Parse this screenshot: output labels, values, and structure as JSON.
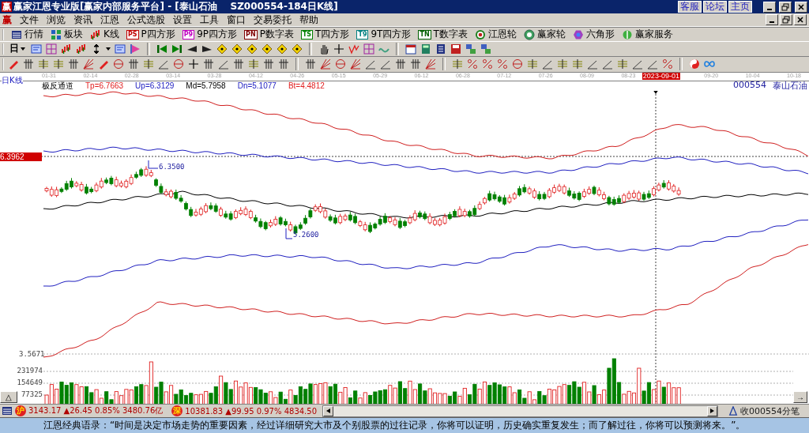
{
  "window": {
    "app_icon": "赢",
    "title": "赢家江恩专业版[赢家内部服务平台] - [泰山石油    SZ000554-184日K线]",
    "links": [
      "客服",
      "论坛",
      "主页"
    ]
  },
  "menu": {
    "app_icon": "赢",
    "items": [
      "文件",
      "浏览",
      "资讯",
      "江恩",
      "公式选股",
      "设置",
      "工具",
      "窗口",
      "交易委托",
      "帮助"
    ]
  },
  "toolbar": {
    "buttons": [
      {
        "kind": "table",
        "label": "行情"
      },
      {
        "kind": "blocks",
        "label": "板块"
      },
      {
        "kind": "candles",
        "label": "K线"
      },
      {
        "kind": "badge",
        "badge": "PS",
        "color": "#c00000",
        "label": "P四方形"
      },
      {
        "kind": "badge",
        "badge": "P9",
        "color": "#c000c0",
        "label": "9P四方形"
      },
      {
        "kind": "badge",
        "badge": "PN",
        "color": "#800000",
        "label": "P数字表"
      },
      {
        "kind": "badge",
        "badge": "TS",
        "color": "#008000",
        "label": "T四方形"
      },
      {
        "kind": "badge",
        "badge": "T9",
        "color": "#008080",
        "label": "9T四方形"
      },
      {
        "kind": "badge",
        "badge": "TN",
        "color": "#006000",
        "label": "T数字表"
      },
      {
        "kind": "target",
        "label": "江恩轮"
      },
      {
        "kind": "wheel",
        "label": "赢家轮"
      },
      {
        "kind": "hexagon",
        "label": "六角形"
      },
      {
        "kind": "coin",
        "label": "赢家服务"
      }
    ]
  },
  "period_selector": "日",
  "chart": {
    "period": "日K线",
    "dates": [
      {
        "label": "01-31",
        "highlighted": false
      },
      {
        "label": "02-14",
        "highlighted": false
      },
      {
        "label": "02-28",
        "highlighted": false
      },
      {
        "label": "03-14",
        "highlighted": false
      },
      {
        "label": "03-28",
        "highlighted": false
      },
      {
        "label": "04-12",
        "highlighted": false
      },
      {
        "label": "04-26",
        "highlighted": false
      },
      {
        "label": "05-15",
        "highlighted": false
      },
      {
        "label": "05-29",
        "highlighted": false
      },
      {
        "label": "06-12",
        "highlighted": false
      },
      {
        "label": "06-28",
        "highlighted": false
      },
      {
        "label": "07-12",
        "highlighted": false
      },
      {
        "label": "07-26",
        "highlighted": false
      },
      {
        "label": "08-09",
        "highlighted": false
      },
      {
        "label": "08-23",
        "highlighted": false
      },
      {
        "label": "2023-09-01",
        "highlighted": true
      },
      {
        "label": "09-20",
        "highlighted": false
      },
      {
        "label": "10-04",
        "highlighted": false
      },
      {
        "label": "10-18",
        "highlighted": false
      }
    ],
    "indicator": {
      "name": "极反通道",
      "values": [
        {
          "text": "Tp=6.7663",
          "color": "#e02020"
        },
        {
          "text": "Up=6.3129",
          "color": "#2020c0"
        },
        {
          "text": "Md=5.7958",
          "color": "#000000"
        },
        {
          "text": "Dn=5.1077",
          "color": "#2020c0"
        },
        {
          "text": "Bt=4.4812",
          "color": "#e02020"
        }
      ]
    },
    "stock_code": "000554",
    "stock_name": "泰山石油",
    "cursor_price": "6.3962",
    "high_label": "6.3500",
    "low_label": "5.2600",
    "lower_price": "3.5671",
    "volume_ticks": [
      "231974",
      "154649",
      "77325"
    ],
    "expand_button": "△",
    "scroll_button": "→"
  },
  "status_bar": {
    "indices": [
      {
        "badge": "沪",
        "text": "3143.17 ▲26.45 0.85% 3480.76亿"
      },
      {
        "badge": "深",
        "text": "10381.83 ▲99.95 0.97% 4834.50"
      }
    ],
    "feed": "收000554分笔"
  },
  "quote": "江恩经典语录：“时间是决定市场走势的重要因素，经过详细研究大市及个别股票的过往记录，你将可以证明，历史确实重复发生；而了解过往，你将可以预测将来。”。"
}
